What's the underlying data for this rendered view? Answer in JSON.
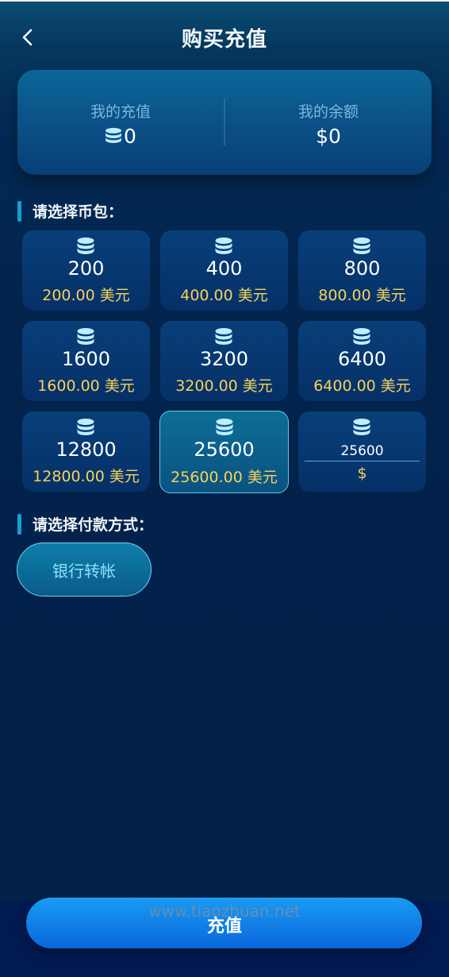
{
  "header": {
    "title": "购买充值"
  },
  "summary": {
    "recharge_label": "我的充值",
    "recharge_value": "0",
    "balance_label": "我的余额",
    "balance_value": "$0"
  },
  "packages_section": {
    "title": "请选择币包："
  },
  "packages": [
    {
      "amount": "200",
      "price": "200.00 美元"
    },
    {
      "amount": "400",
      "price": "400.00 美元"
    },
    {
      "amount": "800",
      "price": "800.00 美元"
    },
    {
      "amount": "1600",
      "price": "1600.00 美元"
    },
    {
      "amount": "3200",
      "price": "3200.00 美元"
    },
    {
      "amount": "6400",
      "price": "6400.00 美元"
    },
    {
      "amount": "12800",
      "price": "12800.00 美元"
    },
    {
      "amount": "25600",
      "price": "25600.00 美元"
    }
  ],
  "selected_package": "25600",
  "custom_package": {
    "value": "25600",
    "currency": "$"
  },
  "payment_section": {
    "title": "请选择付款方式："
  },
  "payment_methods": [
    {
      "label": "银行转帐"
    }
  ],
  "submit": {
    "label": "充值"
  },
  "watermark": "www.tiaozhuan.net",
  "icons": {
    "back": "chevron-left-icon",
    "coin": "coin-stack-icon"
  },
  "colors": {
    "price": "#f6d25a",
    "accent": "#13a0d6",
    "button": "#0a67dd"
  }
}
